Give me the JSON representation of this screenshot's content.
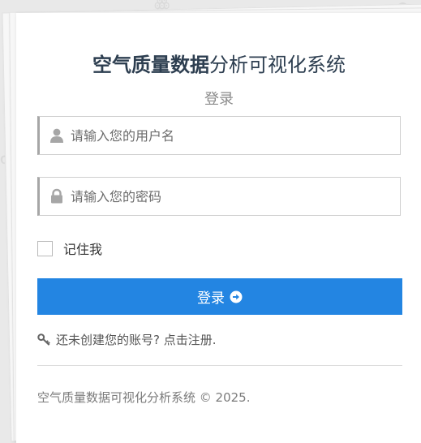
{
  "title": {
    "bold_part": "空气质量数据",
    "rest_part": "分析可视化系统"
  },
  "subtitle": "登录",
  "username": {
    "placeholder": "请输入您的用户名",
    "value": ""
  },
  "password": {
    "placeholder": "请输入您的密码",
    "value": ""
  },
  "remember": {
    "label": "记住我",
    "checked": false
  },
  "login_button": {
    "label": "登录"
  },
  "register_link": "还未创建您的账号? 点击注册.",
  "footer": "空气质量数据可视化分析系统 © 2025.",
  "colors": {
    "primary": "#2385e2",
    "title": "#2d3e50",
    "icon": "#a6a6a6"
  },
  "icons": {
    "username": "user-icon",
    "password": "lock-icon",
    "login": "circle-arrow-right-icon",
    "register": "key-icon"
  }
}
